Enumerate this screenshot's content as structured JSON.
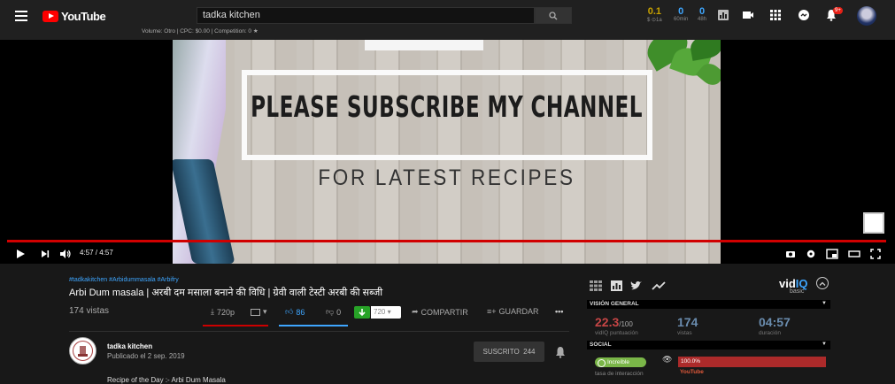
{
  "header": {
    "brand": "YouTube",
    "search_value": "tadka kitchen",
    "keyword_line": "Volume: Otro | CPC: $0.00 | Competition: 0",
    "stats": [
      {
        "value": "0.1",
        "label": "$ ⊙1a",
        "color": "#c8a200"
      },
      {
        "value": "0",
        "label": "60min",
        "color": "#3ea6ff"
      },
      {
        "value": "0",
        "label": "48h",
        "color": "#3ea6ff"
      }
    ],
    "notif_badge": "9+"
  },
  "video": {
    "headline": "PLEASE SUBSCRIBE MY CHANNEL",
    "subline": "FOR LATEST RECIPES",
    "time": "4:57 / 4:57",
    "progress": 1.0
  },
  "info": {
    "hashtags": "#tadkakitchen #Arbidummasala #Arbifry",
    "title": "Arbi Dum masala | अरबी दम मसाला बनाने की विधि | ग्रेवी वाली टेस्टी अरबी की सब्जी",
    "views": "174 vistas",
    "download_quality": "720p",
    "likes": "86",
    "dislikes": "0",
    "dl_select": "720",
    "share": "COMPARTIR",
    "save": "GUARDAR"
  },
  "channel": {
    "name": "tadka kitchen",
    "published": "Publicado el 2 sep. 2019",
    "subscribe": "SUSCRITO",
    "subscribers": "244",
    "description": "Recipe of the Day :- Arbi Dum Masala"
  },
  "vidiq": {
    "logo_a": "vid",
    "logo_b": "IQ",
    "tier": "basic",
    "overview_header": "VISIÓN GENERAL",
    "score": "22.3",
    "score_max": "/100",
    "score_label": "vidIQ puntuación",
    "views": "174",
    "views_label": "vistas",
    "duration": "04:57",
    "duration_label": "duración",
    "social_header": "SOCIAL",
    "engagement_pill": "Increíble",
    "engagement_label": "tasa de interacción",
    "youtube_pct": "100.0%",
    "youtube_label": "YouTube"
  }
}
